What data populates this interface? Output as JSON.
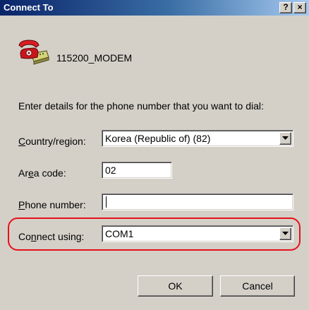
{
  "window": {
    "title": "Connect To",
    "help_glyph": "?",
    "close_glyph": "×"
  },
  "modem": {
    "name": "115200_MODEM",
    "icon": "phone-modem-icon"
  },
  "instructions": "Enter details for the phone number that you want to dial:",
  "fields": {
    "country": {
      "label_accel": "C",
      "label_rest": "ountry/region:",
      "value": "Korea (Republic of) (82)"
    },
    "area_code": {
      "label_pre": "Ar",
      "label_accel": "e",
      "label_rest": "a code:",
      "value": "02"
    },
    "phone": {
      "label_accel": "P",
      "label_rest": "hone number:",
      "value": ""
    },
    "connect_using": {
      "label_pre": "Co",
      "label_accel": "n",
      "label_rest": "nect using:",
      "value": "COM1"
    }
  },
  "buttons": {
    "ok": "OK",
    "cancel": "Cancel"
  },
  "colors": {
    "titlebar_start": "#0a246a",
    "titlebar_end": "#a6caf0",
    "dialog_face": "#d4d0c8",
    "highlight_oval": "#e8101a"
  }
}
